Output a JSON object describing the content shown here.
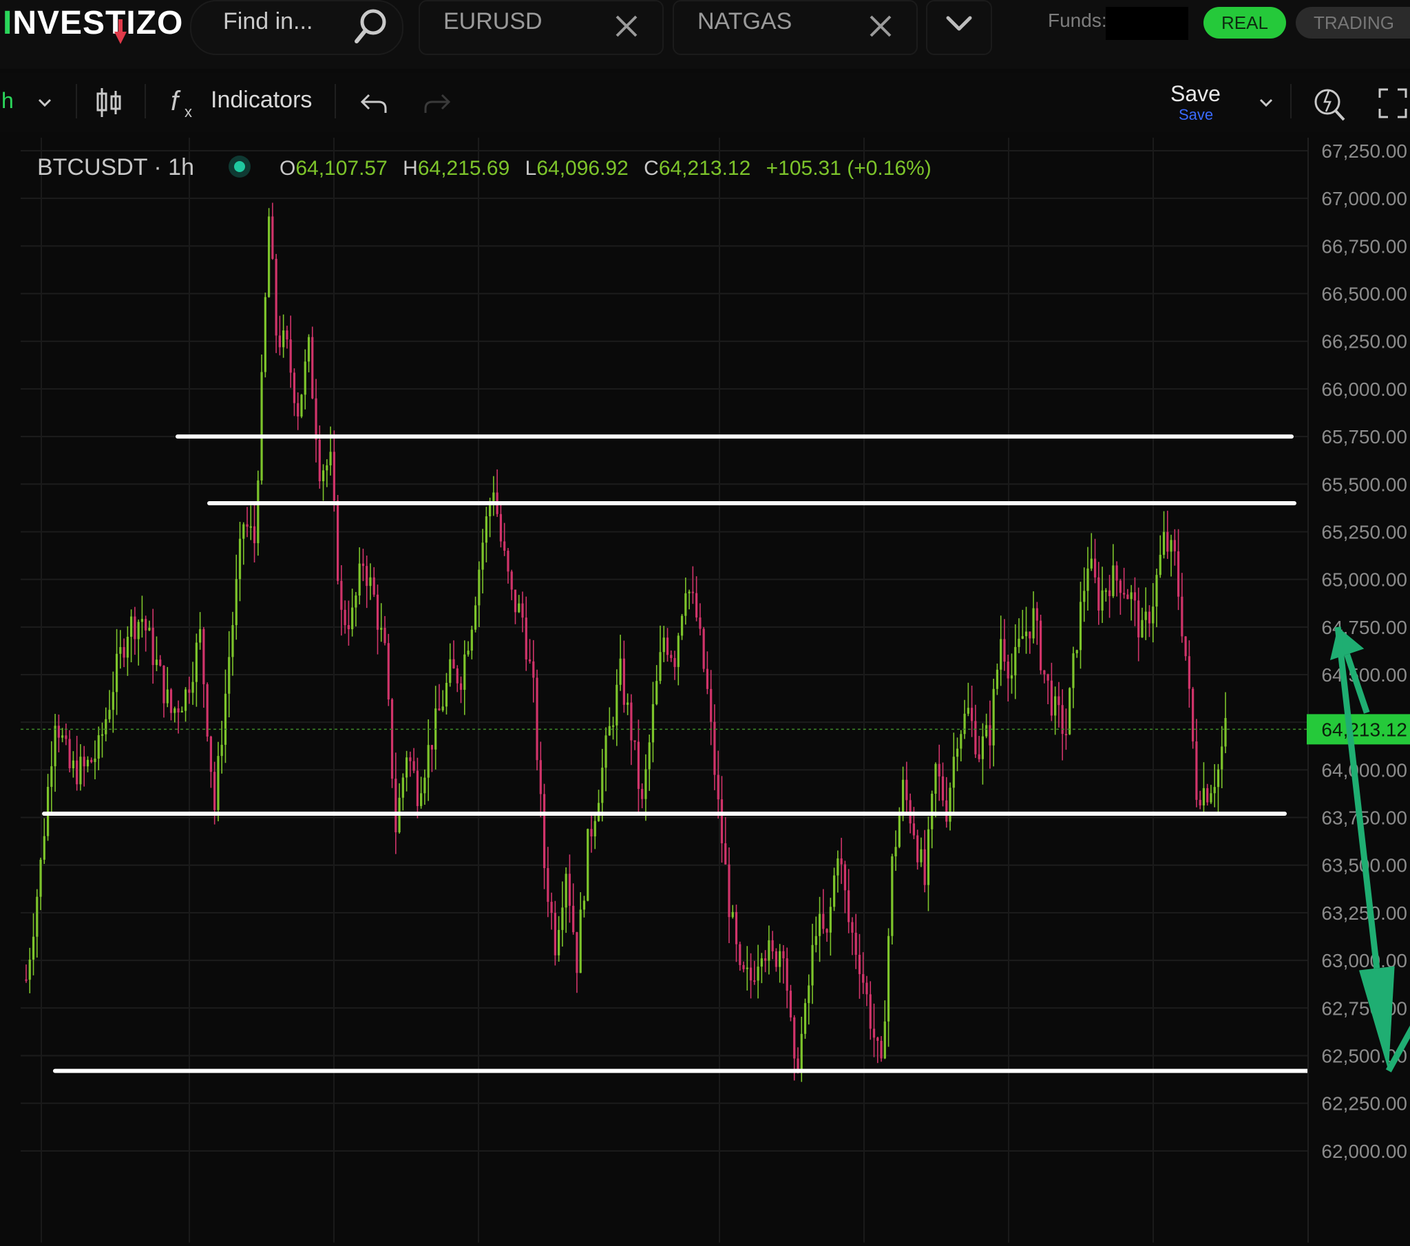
{
  "header": {
    "logo_first": "I",
    "logo_rest": "NVESTIZO",
    "search_placeholder": "Find in...",
    "tabs": [
      {
        "label": "EURUSD"
      },
      {
        "label": "NATGAS"
      }
    ],
    "funds_label": "Funds:",
    "mode_real": "REAL",
    "mode_trading": "TRADING"
  },
  "toolbar": {
    "timeframe": "h",
    "indicators_label": "Indicators",
    "save_label": "Save",
    "save_sub": "Save"
  },
  "legend": {
    "symbol": "BTCUSDT · 1h",
    "o_label": "O",
    "o_value": "64,107.57",
    "h_label": "H",
    "h_value": "64,215.69",
    "l_label": "L",
    "l_value": "64,096.92",
    "c_label": "C",
    "c_value": "64,213.12",
    "change": "+105.31 (+0.16%)"
  },
  "colors": {
    "up": "#7dc42b",
    "down": "#d0346a",
    "accent": "#2bd65b",
    "arrow": "#1fae72",
    "line": "#ffffff"
  },
  "chart_data": {
    "type": "candlestick",
    "symbol": "BTCUSDT",
    "interval": "1h",
    "ylim": [
      61750,
      67350
    ],
    "y_ticks": [
      "67,250.00",
      "67,000.00",
      "66,750.00",
      "66,500.00",
      "66,250.00",
      "66,000.00",
      "65,750.00",
      "65,500.00",
      "65,250.00",
      "65,000.00",
      "64,750.00",
      "64,500.00",
      "64,000.00",
      "63,750.00",
      "63,500.00",
      "63,250.00",
      "63,000.00",
      "62,750.00",
      "62,500.00",
      "62,250.00",
      "62,000.00"
    ],
    "y_tick_values": [
      67250,
      67000,
      66750,
      66500,
      66250,
      66000,
      65750,
      65500,
      65250,
      65000,
      64750,
      64500,
      64000,
      63750,
      63500,
      63250,
      63000,
      62750,
      62500,
      62250,
      62000
    ],
    "last_price": 64213.12,
    "last_price_label": "64,213.12",
    "close_path": [
      [
        0,
        62900
      ],
      [
        4,
        63500
      ],
      [
        8,
        64300
      ],
      [
        12,
        64000
      ],
      [
        16,
        64000
      ],
      [
        20,
        64100
      ],
      [
        24,
        64450
      ],
      [
        28,
        64750
      ],
      [
        32,
        64800
      ],
      [
        36,
        64550
      ],
      [
        40,
        64300
      ],
      [
        44,
        64400
      ],
      [
        48,
        64700
      ],
      [
        52,
        63800
      ],
      [
        56,
        64600
      ],
      [
        60,
        65300
      ],
      [
        63,
        65200
      ],
      [
        65,
        66000
      ],
      [
        67,
        66900
      ],
      [
        69,
        66300
      ],
      [
        72,
        66200
      ],
      [
        75,
        65900
      ],
      [
        78,
        66200
      ],
      [
        81,
        65600
      ],
      [
        84,
        65600
      ],
      [
        87,
        64800
      ],
      [
        90,
        64800
      ],
      [
        93,
        65100
      ],
      [
        96,
        64900
      ],
      [
        99,
        64600
      ],
      [
        102,
        63700
      ],
      [
        105,
        64100
      ],
      [
        108,
        63900
      ],
      [
        111,
        64100
      ],
      [
        114,
        64300
      ],
      [
        117,
        64500
      ],
      [
        120,
        64500
      ],
      [
        123,
        64800
      ],
      [
        126,
        65200
      ],
      [
        129,
        65500
      ],
      [
        131,
        65200
      ],
      [
        134,
        64900
      ],
      [
        137,
        64800
      ],
      [
        140,
        64400
      ],
      [
        143,
        63500
      ],
      [
        146,
        63100
      ],
      [
        149,
        63500
      ],
      [
        152,
        63000
      ],
      [
        155,
        63600
      ],
      [
        158,
        63900
      ],
      [
        161,
        64200
      ],
      [
        164,
        64500
      ],
      [
        167,
        64200
      ],
      [
        170,
        63800
      ],
      [
        173,
        64300
      ],
      [
        176,
        64700
      ],
      [
        179,
        64600
      ],
      [
        182,
        65000
      ],
      [
        185,
        64800
      ],
      [
        188,
        64400
      ],
      [
        191,
        63800
      ],
      [
        194,
        63300
      ],
      [
        197,
        62900
      ],
      [
        200,
        62900
      ],
      [
        203,
        63100
      ],
      [
        206,
        63000
      ],
      [
        209,
        63100
      ],
      [
        212,
        62400
      ],
      [
        215,
        62700
      ],
      [
        218,
        63200
      ],
      [
        221,
        63100
      ],
      [
        224,
        63600
      ],
      [
        227,
        63200
      ],
      [
        230,
        63000
      ],
      [
        233,
        62700
      ],
      [
        236,
        62400
      ],
      [
        239,
        63500
      ],
      [
        242,
        63900
      ],
      [
        245,
        63700
      ],
      [
        248,
        63400
      ],
      [
        251,
        64000
      ],
      [
        254,
        63800
      ],
      [
        257,
        64200
      ],
      [
        260,
        64300
      ],
      [
        263,
        64100
      ],
      [
        266,
        64200
      ],
      [
        269,
        64700
      ],
      [
        272,
        64500
      ],
      [
        275,
        64700
      ],
      [
        278,
        64800
      ],
      [
        281,
        64500
      ],
      [
        284,
        64300
      ],
      [
        287,
        64200
      ],
      [
        290,
        64700
      ],
      [
        293,
        65100
      ],
      [
        296,
        64900
      ],
      [
        299,
        65000
      ],
      [
        302,
        65000
      ],
      [
        305,
        64900
      ],
      [
        308,
        64700
      ],
      [
        311,
        64900
      ],
      [
        314,
        65200
      ],
      [
        317,
        65100
      ],
      [
        320,
        64600
      ],
      [
        323,
        63900
      ],
      [
        326,
        63900
      ],
      [
        329,
        64000
      ],
      [
        331,
        64213
      ]
    ],
    "horizontal_lines": [
      65750,
      65400,
      63770,
      62420
    ],
    "arrows": [
      {
        "from": [
          370,
          64300
        ],
        "to": [
          362,
          64750
        ]
      },
      {
        "from": [
          362,
          64750
        ],
        "to": [
          376,
          62420
        ]
      },
      {
        "from": [
          376,
          62420
        ],
        "to": [
          400,
          63250
        ]
      }
    ]
  }
}
